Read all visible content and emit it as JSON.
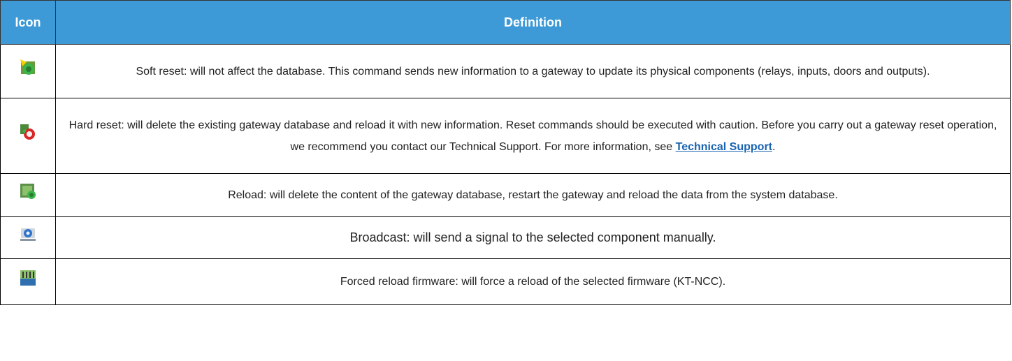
{
  "header": {
    "icon_col": "Icon",
    "definition_col": "Definition"
  },
  "rows": [
    {
      "icon": "soft-reset-icon",
      "text": "Soft reset: will not affect the database. This command sends new information to a gateway to update its physical components (relays, inputs, doors and outputs)."
    },
    {
      "icon": "hard-reset-icon",
      "text_before": "Hard reset: will delete the existing gateway database and reload it with new information. Reset commands should be executed with caution. Before you carry out a gateway reset operation, we recommend you contact our Technical Support. For more information, see ",
      "link": "Technical Support",
      "text_after": "."
    },
    {
      "icon": "reload-icon",
      "text": "Reload: will delete the content of the gateway database, restart the gateway and reload the data from the system database."
    },
    {
      "icon": "broadcast-icon",
      "text": "Broadcast: will send a signal to the selected component manually."
    },
    {
      "icon": "firmware-icon",
      "text": "Forced reload firmware: will force a reload of the selected firmware (KT-NCC)."
    }
  ],
  "colors": {
    "header_bg": "#3d9ad6",
    "link": "#1a63b0"
  }
}
